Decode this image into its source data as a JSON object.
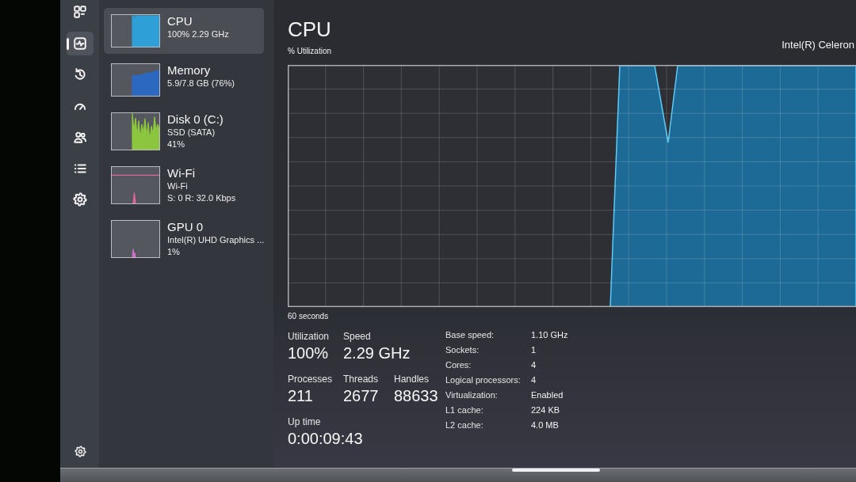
{
  "nav": {
    "items": [
      {
        "selected": false
      },
      {
        "selected": true
      },
      {
        "selected": false
      },
      {
        "selected": false
      },
      {
        "selected": false
      },
      {
        "selected": false
      },
      {
        "selected": false
      }
    ]
  },
  "sidebar": {
    "items": [
      {
        "name": "CPU",
        "details": [
          "100% 2.29 GHz"
        ],
        "selected": true,
        "color": "#2f9fd8"
      },
      {
        "name": "Memory",
        "details": [
          "5.9/7.8 GB (76%)"
        ],
        "selected": false,
        "color": "#2d68c0"
      },
      {
        "name": "Disk 0 (C:)",
        "details": [
          "SSD (SATA)",
          "41%"
        ],
        "selected": false,
        "color": "#8cc63e"
      },
      {
        "name": "Wi-Fi",
        "details": [
          "Wi-Fi",
          "S: 0 R: 32.0 Kbps"
        ],
        "selected": false,
        "color": "#e0679a"
      },
      {
        "name": "GPU 0",
        "details": [
          "Intel(R) UHD Graphics ...",
          "1%"
        ],
        "selected": false,
        "color": "#d070c8"
      }
    ]
  },
  "cpu": {
    "title": "CPU",
    "processor": "Intel(R) Celeron",
    "graph_label": "% Utilization",
    "time_span": "60 seconds",
    "stat_rows": [
      [
        {
          "label": "Utilization",
          "value": "100%"
        },
        {
          "label": "Speed",
          "value": "2.29 GHz"
        }
      ],
      [
        {
          "label": "Processes",
          "value": "211"
        },
        {
          "label": "Threads",
          "value": "2677"
        },
        {
          "label": "Handles",
          "value": "88633"
        }
      ],
      [
        {
          "label": "Up time",
          "value": "0:00:09:43"
        }
      ]
    ],
    "specs": [
      {
        "label": "Base speed:",
        "value": "1.10 GHz"
      },
      {
        "label": "Sockets:",
        "value": "1"
      },
      {
        "label": "Cores:",
        "value": "4"
      },
      {
        "label": "Logical processors:",
        "value": "4"
      },
      {
        "label": "Virtualization:",
        "value": "Enabled"
      },
      {
        "label": "L1 cache:",
        "value": "224 KB"
      },
      {
        "label": "L2 cache:",
        "value": "4.0 MB"
      }
    ]
  }
}
